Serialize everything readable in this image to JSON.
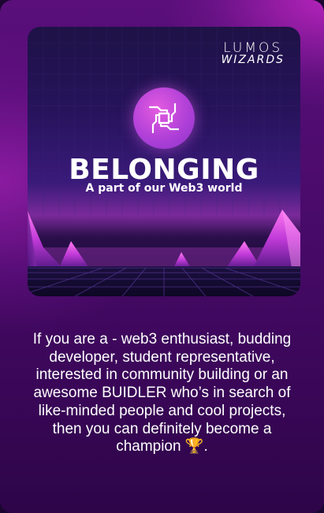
{
  "promo": {
    "brand_line1": "LUMOS",
    "brand_line2": "WIZARDS",
    "headline": "BELONGING",
    "subheadline": "A part of our Web3 world",
    "badge_icon": "four-hands-together-icon"
  },
  "description": {
    "text": "If you are a - web3 enthusiast, budding developer, student representative, interested in community building or an awesome BUIDLER who’s in search of like-minded people and cool projects, then you can definitely become a champion",
    "trophy_emoji": "🏆"
  },
  "colors": {
    "card_bg": "#4a0b6b",
    "accent_magenta": "#d94fe0",
    "promo_bg": "#26135a",
    "text": "#ffffff"
  }
}
